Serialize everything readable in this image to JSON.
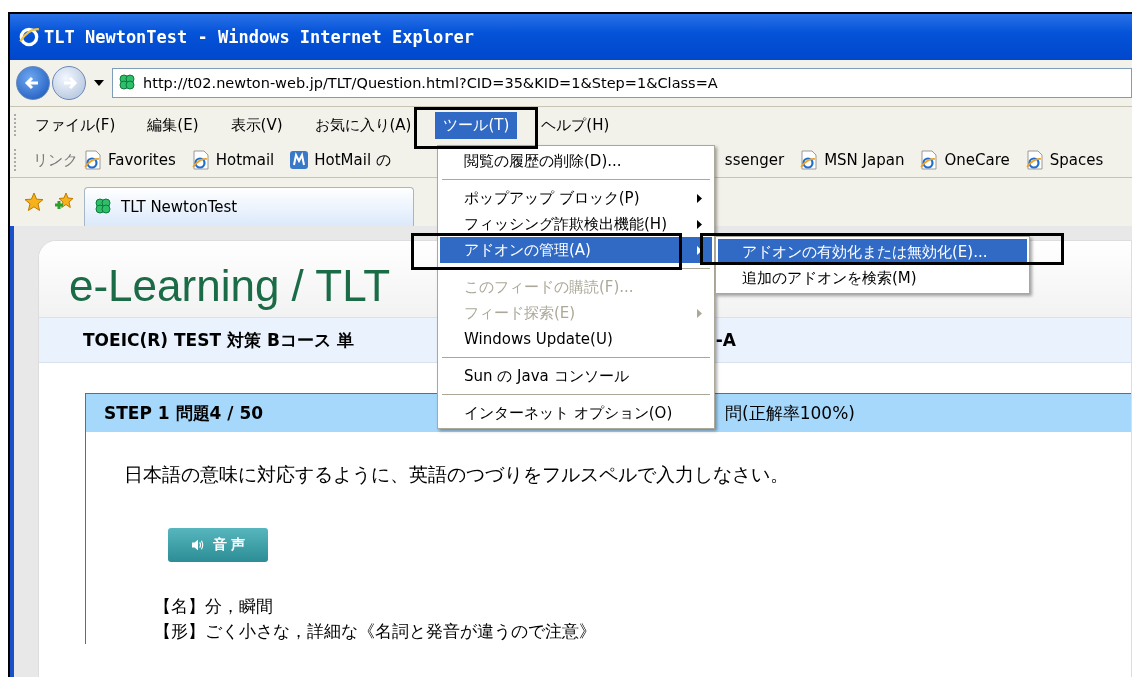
{
  "window": {
    "title": "TLT NewtonTest - Windows Internet Explorer"
  },
  "address_bar": {
    "url": "http://t02.newton-web.jp/TLT/Question.html?CID=35&KID=1&Step=1&Class=A"
  },
  "menu_bar": [
    {
      "label": "ファイル(F)",
      "selected": false
    },
    {
      "label": "編集(E)",
      "selected": false
    },
    {
      "label": "表示(V)",
      "selected": false
    },
    {
      "label": "お気に入り(A)",
      "selected": false
    },
    {
      "label": "ツール(T)",
      "selected": true
    },
    {
      "label": "ヘルプ(H)",
      "selected": false
    }
  ],
  "links_bar": {
    "label": "リンク",
    "links": [
      {
        "label": "Favorites",
        "kind": "ie"
      },
      {
        "label": "Hotmail",
        "kind": "ie"
      },
      {
        "label": "HotMail の",
        "kind": "msn"
      },
      {
        "label": "ssenger",
        "kind": "none"
      },
      {
        "label": "MSN Japan",
        "kind": "ie"
      },
      {
        "label": "OneCare",
        "kind": "ie"
      },
      {
        "label": "Spaces",
        "kind": "ie"
      }
    ]
  },
  "tabs": [
    {
      "label": "TLT NewtonTest",
      "selected": true
    }
  ],
  "tools_menu": [
    {
      "kind": "item",
      "label": "閲覧の履歴の削除(D)...",
      "selected": false,
      "disabled": false,
      "submenu": false
    },
    {
      "kind": "separator"
    },
    {
      "kind": "item",
      "label": "ポップアップ ブロック(P)",
      "selected": false,
      "disabled": false,
      "submenu": true
    },
    {
      "kind": "item",
      "label": "フィッシング詐欺検出機能(H)",
      "selected": false,
      "disabled": false,
      "submenu": true
    },
    {
      "kind": "item",
      "label": "アドオンの管理(A)",
      "selected": true,
      "disabled": false,
      "submenu": true
    },
    {
      "kind": "separator"
    },
    {
      "kind": "item",
      "label": "このフィードの購読(F)...",
      "selected": false,
      "disabled": true,
      "submenu": false
    },
    {
      "kind": "item",
      "label": "フィード探索(E)",
      "selected": false,
      "disabled": true,
      "submenu": true
    },
    {
      "kind": "item",
      "label": "Windows Update(U)",
      "selected": false,
      "disabled": false,
      "submenu": false
    },
    {
      "kind": "separator"
    },
    {
      "kind": "item",
      "label": "Sun の Java コンソール",
      "selected": false,
      "disabled": false,
      "submenu": false
    },
    {
      "kind": "separator"
    },
    {
      "kind": "item",
      "label": "インターネット オプション(O)",
      "selected": false,
      "disabled": false,
      "submenu": false
    }
  ],
  "addons_submenu": [
    {
      "label": "アドオンの有効化または無効化(E)...",
      "selected": true
    },
    {
      "label": "追加のアドオンを検索(M)",
      "selected": false
    }
  ],
  "page": {
    "logo": "e-Learning / TLT",
    "course_left": "TOEIC(R) TEST 対策 Bコース 単",
    "course_right": "-A",
    "step_left": "STEP 1  問題4 / 50",
    "step_right": "問(正解率100%)",
    "instruction": "日本語の意味に対応するように、英語のつづりをフルスペルで入力しなさい。",
    "audio_button": "音 声",
    "definitions": [
      "【名】分，瞬間",
      "【形】ごく小さな，詳細な《名詞と発音が違うので注意》"
    ]
  }
}
